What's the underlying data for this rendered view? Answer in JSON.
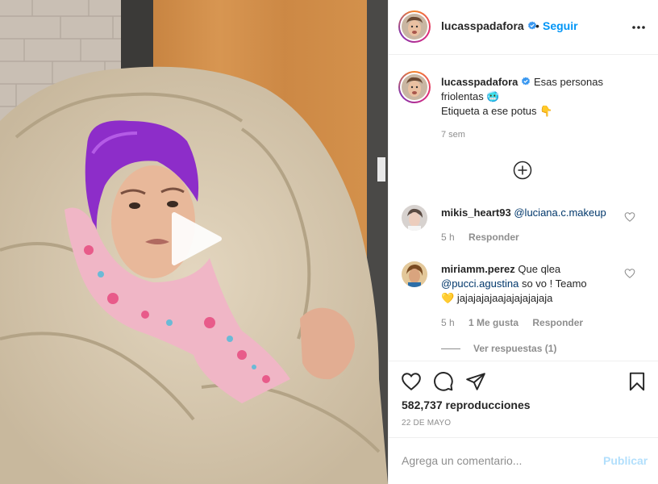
{
  "post": {
    "username": "lucasspadafora",
    "follow_separator": "•",
    "follow_label": "Seguir",
    "caption_line1": "Esas personas friolentas",
    "caption_emoji1": "🥶",
    "caption_line2": "Etiqueta a ese potus",
    "caption_emoji2": "👇",
    "caption_time": "7 sem",
    "views": "582,737 reproducciones",
    "date": "22 DE MAYO"
  },
  "comments": [
    {
      "username": "mikis_heart93",
      "mention": "@luciana.c.makeup",
      "time": "5 h",
      "reply_label": "Responder"
    },
    {
      "username": "miriamm.perez",
      "text_before": "Que qlea",
      "mention": "@pucci.agustina",
      "text_after": "so vo ! Teamo",
      "emoji": "💛",
      "text_end": "jajajajajaajajajajajaja",
      "time": "5 h",
      "likes_label": "1 Me gusta",
      "reply_label": "Responder",
      "view_replies": "Ver respuestas (1)"
    }
  ],
  "add_comment": {
    "placeholder": "Agrega un comentario...",
    "publish_label": "Publicar"
  },
  "icons": {
    "verified": "verified-badge-icon",
    "more": "more-options-icon",
    "load_more": "plus-circle-icon",
    "like": "heart-icon",
    "comment": "comment-icon",
    "share": "paper-plane-icon",
    "save": "bookmark-icon",
    "play": "play-icon"
  },
  "colors": {
    "accent": "#0095f6",
    "verified": "#3897f0",
    "publish_disabled": "#b2dffc",
    "muted": "#8e8e8e"
  }
}
